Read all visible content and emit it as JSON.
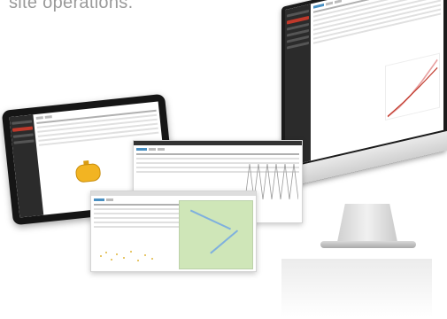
{
  "caption": "site operations.",
  "colors": {
    "accent_red": "#c0392b",
    "chart_blue": "#4a90c2",
    "tank_yellow": "#f2b422",
    "map_green": "#cfe6b8",
    "line_pink": "#e8a0a0"
  },
  "icons": [
    "apple-icon"
  ],
  "devices": [
    "imac",
    "tablet",
    "browser-window",
    "browser-window"
  ]
}
